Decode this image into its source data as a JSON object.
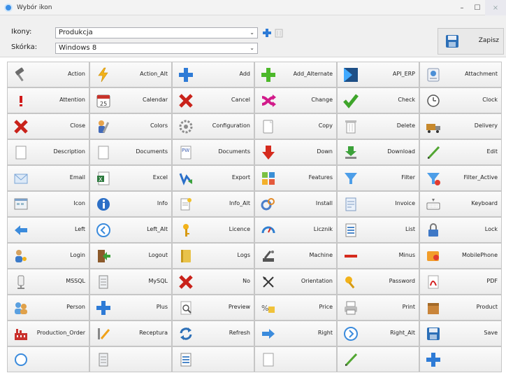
{
  "window": {
    "title": "Wybór ikon"
  },
  "form": {
    "ikony_label": "Ikony:",
    "ikony_value": "Produkcja",
    "skorka_label": "Skórka:",
    "skorka_value": "Windows 8",
    "save_label": "Zapisz"
  },
  "icons": [
    {
      "label": "Action",
      "icon": "hammer-icon"
    },
    {
      "label": "Action_Alt",
      "icon": "lightning-icon"
    },
    {
      "label": "Add",
      "icon": "plus-blue-icon"
    },
    {
      "label": "Add_Alternate",
      "icon": "plus-green-icon"
    },
    {
      "label": "API_ERP",
      "icon": "api-icon"
    },
    {
      "label": "Attachment",
      "icon": "attachment-icon"
    },
    {
      "label": "Attention",
      "icon": "exclamation-icon"
    },
    {
      "label": "Calendar",
      "icon": "calendar-icon"
    },
    {
      "label": "Cancel",
      "icon": "x-red-icon"
    },
    {
      "label": "Change",
      "icon": "shuffle-icon"
    },
    {
      "label": "Check",
      "icon": "check-icon"
    },
    {
      "label": "Clock",
      "icon": "clock-icon"
    },
    {
      "label": "Close",
      "icon": "x-red-icon"
    },
    {
      "label": "Colors",
      "icon": "palette-icon"
    },
    {
      "label": "Configuration",
      "icon": "gear-icon"
    },
    {
      "label": "Copy",
      "icon": "copy-icon"
    },
    {
      "label": "Delete",
      "icon": "trash-icon"
    },
    {
      "label": "Delivery",
      "icon": "truck-icon"
    },
    {
      "label": "Description",
      "icon": "document-icon"
    },
    {
      "label": "Documents",
      "icon": "document-icon"
    },
    {
      "label": "Documents",
      "icon": "pw-document-icon"
    },
    {
      "label": "Down",
      "icon": "arrow-down-icon"
    },
    {
      "label": "Download",
      "icon": "download-icon"
    },
    {
      "label": "Edit",
      "icon": "pencil-icon"
    },
    {
      "label": "Email",
      "icon": "envelope-icon"
    },
    {
      "label": "Excel",
      "icon": "excel-icon"
    },
    {
      "label": "Export",
      "icon": "export-icon"
    },
    {
      "label": "Features",
      "icon": "puzzle-icon"
    },
    {
      "label": "Filter",
      "icon": "filter-icon"
    },
    {
      "label": "Filter_Active",
      "icon": "filter-active-icon"
    },
    {
      "label": "Icon",
      "icon": "window-icon"
    },
    {
      "label": "Info",
      "icon": "info-icon"
    },
    {
      "label": "Info_Alt",
      "icon": "info-doc-icon"
    },
    {
      "label": "Install",
      "icon": "install-icon"
    },
    {
      "label": "Invoice",
      "icon": "invoice-icon"
    },
    {
      "label": "Keyboard",
      "icon": "keyboard-icon"
    },
    {
      "label": "Left",
      "icon": "arrow-left-icon"
    },
    {
      "label": "Left_Alt",
      "icon": "circle-left-icon"
    },
    {
      "label": "Licence",
      "icon": "key-icon"
    },
    {
      "label": "Licznik",
      "icon": "gauge-icon"
    },
    {
      "label": "List",
      "icon": "list-icon"
    },
    {
      "label": "Lock",
      "icon": "lock-icon"
    },
    {
      "label": "Login",
      "icon": "user-key-icon"
    },
    {
      "label": "Logout",
      "icon": "logout-icon"
    },
    {
      "label": "Logs",
      "icon": "book-icon"
    },
    {
      "label": "Machine",
      "icon": "machine-icon"
    },
    {
      "label": "Minus",
      "icon": "minus-icon"
    },
    {
      "label": "MobilePhone",
      "icon": "phone-icon"
    },
    {
      "label": "MSSQL",
      "icon": "database-icon"
    },
    {
      "label": "MySQL",
      "icon": "server-icon"
    },
    {
      "label": "No",
      "icon": "x-red-icon"
    },
    {
      "label": "Orientation",
      "icon": "compass-icon"
    },
    {
      "label": "Password",
      "icon": "password-key-icon"
    },
    {
      "label": "PDF",
      "icon": "pdf-icon"
    },
    {
      "label": "Person",
      "icon": "people-icon"
    },
    {
      "label": "Plus",
      "icon": "plus-blue-icon"
    },
    {
      "label": "Preview",
      "icon": "preview-icon"
    },
    {
      "label": "Price",
      "icon": "price-icon"
    },
    {
      "label": "Print",
      "icon": "printer-icon"
    },
    {
      "label": "Product",
      "icon": "box-icon"
    },
    {
      "label": "Production_Order",
      "icon": "factory-icon"
    },
    {
      "label": "Receptura",
      "icon": "recipe-icon"
    },
    {
      "label": "Refresh",
      "icon": "refresh-icon"
    },
    {
      "label": "Right",
      "icon": "arrow-right-icon"
    },
    {
      "label": "Right_Alt",
      "icon": "circle-right-icon"
    },
    {
      "label": "Save",
      "icon": "floppy-icon"
    },
    {
      "label": "",
      "icon": "circle-icon"
    },
    {
      "label": "",
      "icon": "server-icon"
    },
    {
      "label": "",
      "icon": "list-icon"
    },
    {
      "label": "",
      "icon": "document-icon"
    },
    {
      "label": "",
      "icon": "pencil-icon"
    },
    {
      "label": "",
      "icon": "plus-blue-icon"
    }
  ]
}
